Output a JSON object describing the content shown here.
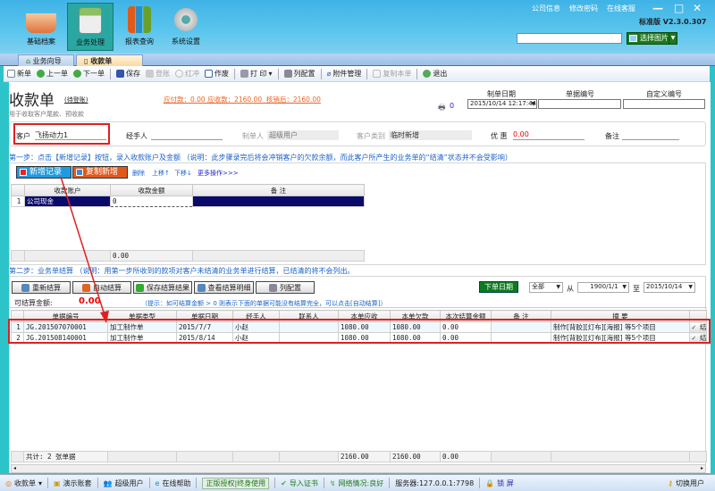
{
  "header": {
    "nav": [
      {
        "label": "基础档案",
        "icon": "basket-icon"
      },
      {
        "label": "业务处理",
        "icon": "calculator-icon"
      },
      {
        "label": "报表查询",
        "icon": "bar-chart-icon"
      },
      {
        "label": "系统设置",
        "icon": "gear-icon"
      }
    ],
    "links": [
      "公司信息",
      "修改密码",
      "在线客服"
    ],
    "version": "标准版 V2.3.0.307",
    "select_image": "选择图片"
  },
  "tabs": [
    {
      "label": "业务向导"
    },
    {
      "label": "收款单"
    }
  ],
  "toolbar": [
    "新单",
    "上一单",
    "下一单",
    "保存",
    "登账",
    "红冲",
    "作废",
    "打 印",
    "列配置",
    "附件管理",
    "复制本单",
    "退出"
  ],
  "form": {
    "title": "收款单",
    "status": "(待登账)",
    "summary": "应付款：0.00 应收款：2160.00  核销后：2160.00",
    "subtitle": "用于收取客户尾款、预收款",
    "print_count": "0",
    "date_label": "制单日期",
    "date_value": "2015/10/14 12:17:44",
    "docno_label": "单据编号",
    "custom_label": "自定义编号",
    "customer_label": "客户",
    "customer_value": "飞扬动力1",
    "handler_label": "经手人",
    "maker_label": "制单人",
    "maker_value": "超级用户",
    "ctype_label": "客户类别",
    "ctype_value": "临时新增",
    "discount_label": "优 惠",
    "discount_value": "0.00",
    "remark_label": "备注"
  },
  "step1": {
    "text": "第一步：点击【新增记录】按钮，录入收款账户及金额 （说明：此步骤录完后将会冲销客户的欠款余额，而此客户所产生的业务单的“结清”状态并不会受影响）",
    "add": "新增记录",
    "copy": "复制新增",
    "links": [
      "删除",
      "上移↑",
      "下移↓",
      "更多操作>>>"
    ],
    "columns": [
      "收款账户",
      "收款金额",
      "备 注"
    ],
    "rows": [
      {
        "no": "1",
        "account": "公司现金",
        "amount": "0",
        "remark": ""
      }
    ],
    "total": "0.00"
  },
  "step2": {
    "text": "第二步：业务单结算 （说明：用第一步所收到的款项对客户未结清的业务单进行结算，已结清的将不会列出。",
    "buttons": [
      "重新结算",
      "自动结算",
      "保存结算结果",
      "查看结算明细",
      "列配置"
    ],
    "date_btn": "下单日期",
    "range": "全部",
    "from_label": "从",
    "from": "1900/1/1",
    "to_label": "至",
    "to": "2015/10/14",
    "settle_label": "可结算金额:",
    "settle_value": "0.00",
    "hint": "（提示：如可结算金额 > 0 则表示下面的单据可能没有结算完全，可以点击[自动结算]）",
    "columns": [
      "单据编号",
      "单据类型",
      "单据日期",
      "经手人",
      "联系人",
      "本单应收",
      "本单欠款",
      "本次结算金额",
      "备 注",
      "摘 要",
      ""
    ],
    "rows": [
      {
        "no": "1",
        "id": "JG.201507070001",
        "type": "加工制作单",
        "date": "2015/7/7",
        "handler": "小赵",
        "contact": "",
        "recv": "1080.00",
        "owe": "1080.00",
        "settle": "0.00",
        "remark": "",
        "summary": "制作[背胶][灯布][海报] 等5个项目",
        "act": "✓ 结"
      },
      {
        "no": "2",
        "id": "JG.201508140001",
        "type": "加工制作单",
        "date": "2015/8/14",
        "handler": "小赵",
        "contact": "",
        "recv": "1080.00",
        "owe": "1080.00",
        "settle": "0.00",
        "remark": "",
        "summary": "制作[背胶][灯布][海报] 等5个项目",
        "act": "✓ 结"
      }
    ],
    "footer": {
      "count": "共计: 2 张单据",
      "recv": "2160.00",
      "owe": "2160.00",
      "settle": "0.00"
    }
  },
  "statusbar": {
    "doc": "收款单",
    "demo": "演示账套",
    "user": "超级用户",
    "help": "在线帮助",
    "license": "正版授权|终身使用",
    "cert": "导入证书",
    "network": "网络情况:良好",
    "server": "服务器:127.0.0.1:7798",
    "lock": "锁 屏",
    "switch": "切换用户"
  }
}
